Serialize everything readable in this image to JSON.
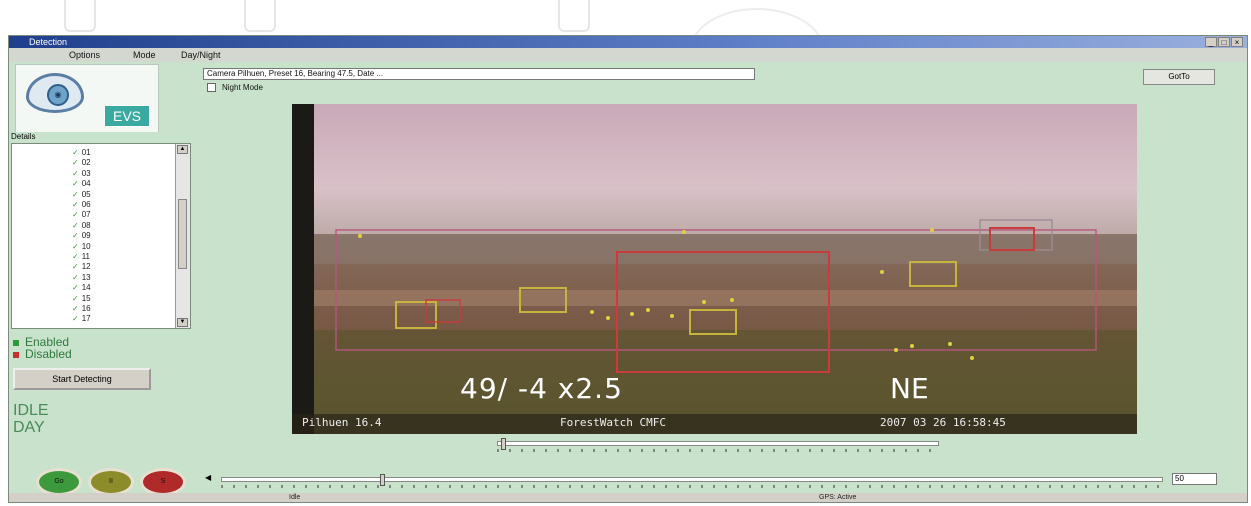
{
  "window": {
    "title": "Detection",
    "controls": [
      "_",
      "□",
      "×"
    ]
  },
  "menu": [
    "Options",
    "Mode",
    "Day/Night"
  ],
  "logo": {
    "text": "EVS",
    "mark": "eye-logo"
  },
  "sidebar": {
    "details_label": "Details",
    "items": [
      "01",
      "02",
      "03",
      "04",
      "05",
      "06",
      "07",
      "08",
      "09",
      "10",
      "11",
      "12",
      "13",
      "14",
      "15",
      "16",
      "17"
    ],
    "legend": [
      {
        "label": "Enabled",
        "color": "#2e9a3c"
      },
      {
        "label": "Disabled",
        "color": "#c83030"
      }
    ],
    "start_button": "Start Detecting",
    "state": "IDLE",
    "mode": "DAY"
  },
  "top": {
    "camera_info": "Camera Pilhuen, Preset 16, Bearing 47.5, Date ...",
    "goto_button": "GotTo",
    "night_mode_label": "Night Mode"
  },
  "video": {
    "osd_position": "49/ -4 x2.5",
    "osd_direction": "NE",
    "osd_camera": "Pilhuen 16.4",
    "osd_system": "ForestWatch CMFC",
    "osd_timestamp": "2007 03 26 16:58:45"
  },
  "controls": {
    "round_buttons": [
      "Go",
      "II",
      "S"
    ],
    "round_colors": [
      "#3c9a3c",
      "#8c8c2a",
      "#b02a2a"
    ],
    "value_box": "50",
    "upper_slider_value": 0.01,
    "lower_slider_value": 0.17
  },
  "statusbar": {
    "left": "Idle",
    "right": "GPS: Active"
  }
}
